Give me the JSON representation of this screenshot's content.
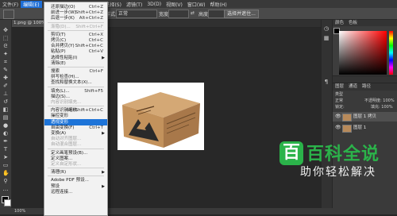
{
  "menubar": {
    "items": [
      "文件(F)",
      "编辑(E)",
      "图像(I)",
      "图层(L)",
      "文字(Y)",
      "选择(S)",
      "滤镜(T)",
      "3D(D)",
      "视图(V)",
      "窗口(W)",
      "帮助(H)"
    ],
    "active_index": 1
  },
  "options_bar": {
    "style_label": "样式:",
    "style_value": "正常",
    "width_label": "宽度:",
    "height_label": "高度:",
    "select_mask_button": "选择并遮住..."
  },
  "document": {
    "tab_label": "1.png @ 100% (图层 1, RGB/8)"
  },
  "status_bar": {
    "zoom": "100%"
  },
  "edit_menu": {
    "items": [
      {
        "label": "还原描边(O)",
        "shortcut": "Ctrl+Z",
        "disabled": false
      },
      {
        "label": "前进一步(W)",
        "shortcut": "Shift+Ctrl+Z",
        "disabled": false
      },
      {
        "label": "后退一步(K)",
        "shortcut": "Alt+Ctrl+Z",
        "disabled": false
      },
      {
        "sep": true
      },
      {
        "label": "渐隐(D)...",
        "shortcut": "Shift+Ctrl+F",
        "disabled": true
      },
      {
        "sep": true
      },
      {
        "label": "剪切(T)",
        "shortcut": "Ctrl+X",
        "disabled": false
      },
      {
        "label": "拷贝(C)",
        "shortcut": "Ctrl+C",
        "disabled": false
      },
      {
        "label": "合并拷贝(Y)",
        "shortcut": "Shift+Ctrl+C",
        "disabled": false
      },
      {
        "label": "粘贴(P)",
        "shortcut": "Ctrl+V",
        "disabled": false
      },
      {
        "label": "选择性粘贴(I)",
        "shortcut": "",
        "disabled": false,
        "submenu": true
      },
      {
        "label": "清除(E)",
        "shortcut": "",
        "disabled": false
      },
      {
        "sep": true
      },
      {
        "label": "搜索",
        "shortcut": "Ctrl+F",
        "disabled": false
      },
      {
        "label": "拼写检查(H)...",
        "shortcut": "",
        "disabled": false
      },
      {
        "label": "查找和替换文本(X)...",
        "shortcut": "",
        "disabled": false
      },
      {
        "sep": true
      },
      {
        "label": "填充(L)...",
        "shortcut": "Shift+F5",
        "disabled": false
      },
      {
        "label": "描边(S)...",
        "shortcut": "",
        "disabled": false
      },
      {
        "label": "内容识别填充...",
        "shortcut": "",
        "disabled": true
      },
      {
        "sep": true
      },
      {
        "label": "内容识别缩放",
        "shortcut": "Alt+Shift+Ctrl+C",
        "disabled": false
      },
      {
        "label": "操控变形",
        "shortcut": "",
        "disabled": false
      },
      {
        "label": "透视变形",
        "shortcut": "",
        "disabled": false,
        "highlight": true
      },
      {
        "label": "自由变换(F)",
        "shortcut": "Ctrl+T",
        "disabled": false
      },
      {
        "label": "变换(A)",
        "shortcut": "",
        "disabled": false,
        "submenu": true
      },
      {
        "label": "自动对齐图层...",
        "shortcut": "",
        "disabled": true
      },
      {
        "label": "自动混合图层...",
        "shortcut": "",
        "disabled": true
      },
      {
        "sep": true
      },
      {
        "label": "定义画笔预设(B)...",
        "shortcut": "",
        "disabled": false
      },
      {
        "label": "定义图案...",
        "shortcut": "",
        "disabled": false
      },
      {
        "label": "定义自定形状...",
        "shortcut": "",
        "disabled": true
      },
      {
        "sep": true
      },
      {
        "label": "清理(R)",
        "shortcut": "",
        "disabled": false,
        "submenu": true
      },
      {
        "sep": true
      },
      {
        "label": "Adobe PDF 预设...",
        "shortcut": "",
        "disabled": false
      },
      {
        "label": "预设",
        "shortcut": "",
        "disabled": false,
        "submenu": true
      },
      {
        "label": "远程连接...",
        "shortcut": "",
        "disabled": false
      }
    ]
  },
  "color_panel": {
    "tabs": [
      "颜色",
      "色板"
    ],
    "colors": {
      "hue_base": "#ff0000",
      "foreground": "#000000",
      "background": "#ffffff"
    }
  },
  "layers_panel": {
    "tabs": [
      "图层",
      "通道",
      "路径"
    ],
    "filter_label": "类型",
    "blend_mode": "正常",
    "opacity_label": "不透明度: 100%",
    "lock_label": "锁定:",
    "fill_label": "填充: 100%",
    "layers": [
      {
        "name": "图层 1 拷贝",
        "visible": true
      },
      {
        "name": "图层 1",
        "visible": true
      }
    ]
  },
  "watermark": {
    "logo_char": "百",
    "title": "百科全说",
    "subtitle": "助你轻松解决"
  }
}
